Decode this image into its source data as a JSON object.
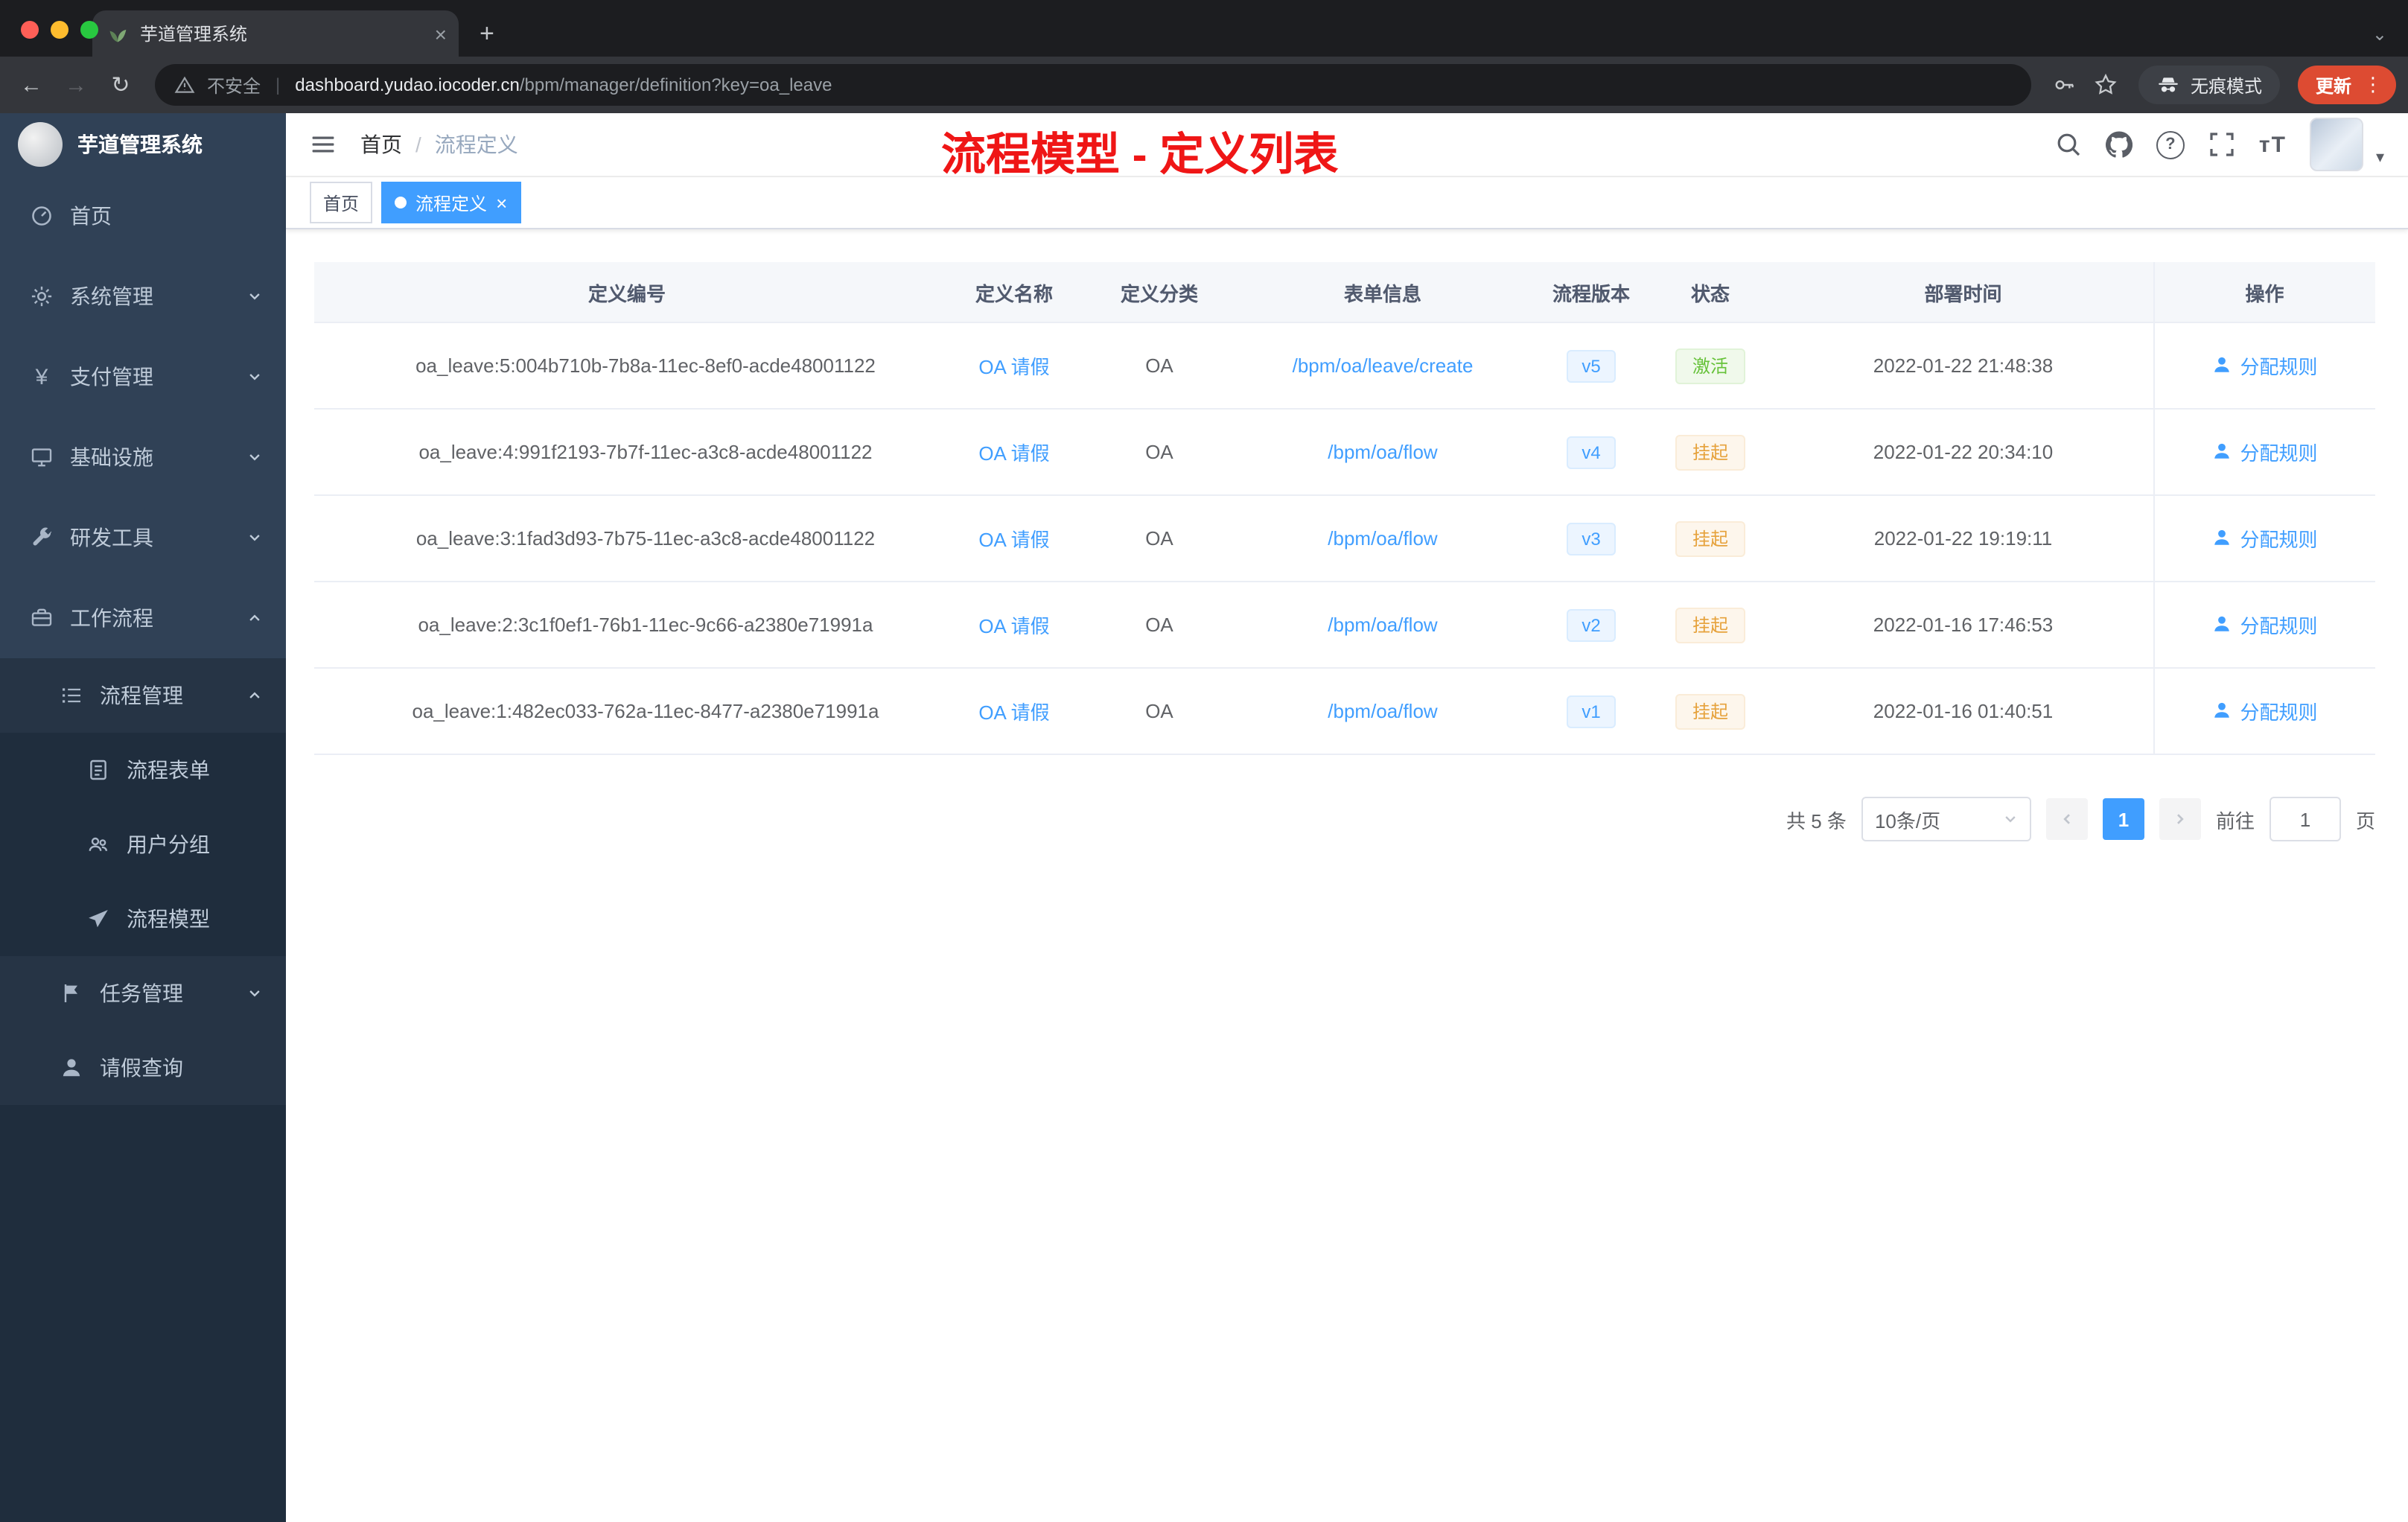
{
  "colors": {
    "accent": "#409eff",
    "annotation_red": "#ef1616",
    "success": "#67c23a",
    "warning": "#e6a23c",
    "sidebar_bg": "#304156",
    "active_tag_bg": "#409eff"
  },
  "icons": {
    "question": "?",
    "more": "⋮",
    "caret_down": "▾",
    "chevron_down": "⌄",
    "back": "←",
    "forward": "→",
    "reload": "↻",
    "plus": "+",
    "close": "×",
    "divider": "|",
    "font_size": "тT"
  },
  "browser": {
    "tab": {
      "title": "芋道管理系统"
    },
    "address": {
      "security": "不安全",
      "host": "dashboard.yudao.iocoder.cn",
      "path": "/bpm/manager/definition?key=oa_leave"
    },
    "incognito": "无痕模式",
    "update": "更新"
  },
  "sidebar": {
    "logo": "芋道管理系统",
    "menu": [
      {
        "label": "首页",
        "level": 1,
        "icon": "dashboard-icon",
        "arrow": ""
      },
      {
        "label": "系统管理",
        "level": 1,
        "icon": "gear-icon",
        "arrow": "down"
      },
      {
        "label": "支付管理",
        "level": 1,
        "icon": "yen-icon",
        "arrow": "down"
      },
      {
        "label": "基础设施",
        "level": 1,
        "icon": "monitor-icon",
        "arrow": "down"
      },
      {
        "label": "研发工具",
        "level": 1,
        "icon": "wrench-icon",
        "arrow": "down"
      },
      {
        "label": "工作流程",
        "level": 1,
        "icon": "briefcase-icon",
        "arrow": "up"
      },
      {
        "label": "流程管理",
        "level": 2,
        "icon": "list-icon",
        "arrow": "up"
      },
      {
        "label": "流程表单",
        "level": 3,
        "icon": "form-icon",
        "arrow": ""
      },
      {
        "label": "用户分组",
        "level": 3,
        "icon": "group-icon",
        "arrow": ""
      },
      {
        "label": "流程模型",
        "level": 3,
        "icon": "plane-icon",
        "arrow": ""
      },
      {
        "label": "任务管理",
        "level": 2,
        "icon": "flag-icon",
        "arrow": "down"
      },
      {
        "label": "请假查询",
        "level": 2,
        "icon": "user-icon",
        "arrow": ""
      }
    ]
  },
  "navbar": {
    "breadcrumb": {
      "root": "首页",
      "sep": "/",
      "current": "流程定义"
    },
    "annotation": "流程模型 - 定义列表"
  },
  "tags": {
    "items": [
      {
        "label": "首页",
        "active": false
      },
      {
        "label": "流程定义",
        "active": true
      }
    ]
  },
  "table": {
    "columns": [
      "定义编号",
      "定义名称",
      "定义分类",
      "表单信息",
      "流程版本",
      "状态",
      "部署时间",
      "操作"
    ],
    "rows": [
      {
        "id": "oa_leave:5:004b710b-7b8a-11ec-8ef0-acde48001122",
        "name": "OA 请假",
        "category": "OA",
        "form": "/bpm/oa/leave/create",
        "version": "v5",
        "status": "激活",
        "status_type": "success",
        "deployed_at": "2022-01-22 21:48:38",
        "action": "分配规则"
      },
      {
        "id": "oa_leave:4:991f2193-7b7f-11ec-a3c8-acde48001122",
        "name": "OA 请假",
        "category": "OA",
        "form": "/bpm/oa/flow",
        "version": "v4",
        "status": "挂起",
        "status_type": "warning",
        "deployed_at": "2022-01-22 20:34:10",
        "action": "分配规则"
      },
      {
        "id": "oa_leave:3:1fad3d93-7b75-11ec-a3c8-acde48001122",
        "name": "OA 请假",
        "category": "OA",
        "form": "/bpm/oa/flow",
        "version": "v3",
        "status": "挂起",
        "status_type": "warning",
        "deployed_at": "2022-01-22 19:19:11",
        "action": "分配规则"
      },
      {
        "id": "oa_leave:2:3c1f0ef1-76b1-11ec-9c66-a2380e71991a",
        "name": "OA 请假",
        "category": "OA",
        "form": "/bpm/oa/flow",
        "version": "v2",
        "status": "挂起",
        "status_type": "warning",
        "deployed_at": "2022-01-16 17:46:53",
        "action": "分配规则"
      },
      {
        "id": "oa_leave:1:482ec033-762a-11ec-8477-a2380e71991a",
        "name": "OA 请假",
        "category": "OA",
        "form": "/bpm/oa/flow",
        "version": "v1",
        "status": "挂起",
        "status_type": "warning",
        "deployed_at": "2022-01-16 01:40:51",
        "action": "分配规则"
      }
    ]
  },
  "pagination": {
    "total": "共 5 条",
    "page_size": "10条/页",
    "current_page": "1",
    "goto_label": "前往",
    "goto_value": "1",
    "page_unit": "页"
  }
}
